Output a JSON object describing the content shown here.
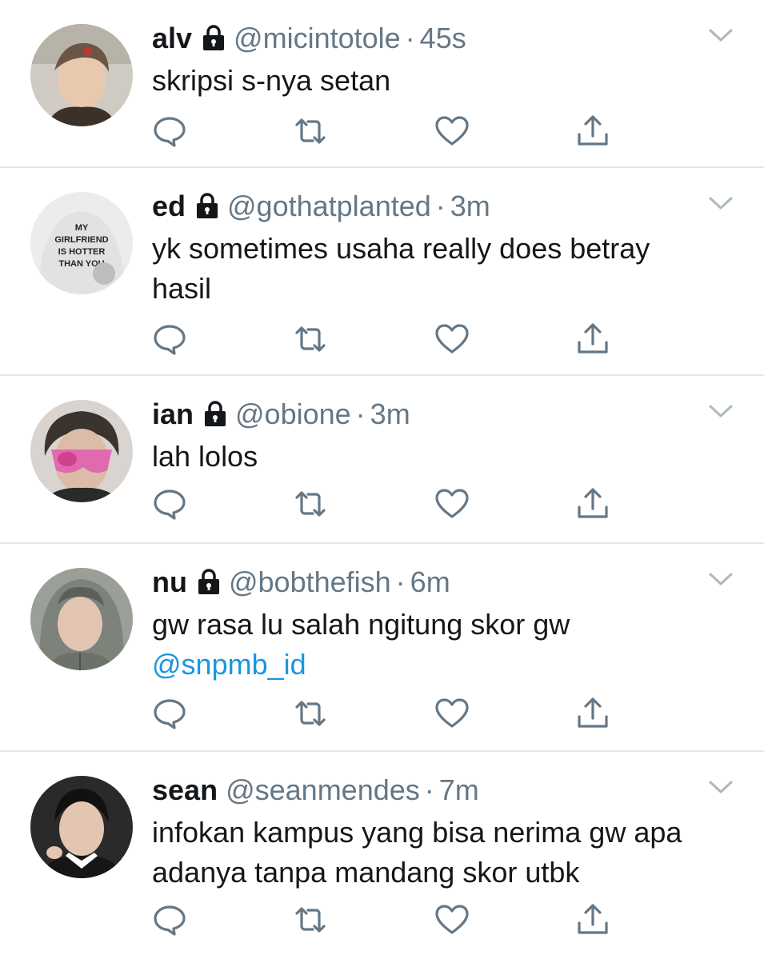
{
  "tweets": [
    {
      "name": "alv",
      "handle": "@micintotole",
      "time": "45s",
      "locked": true,
      "text": "skripsi s-nya setan",
      "mention": "",
      "avatar_icon": "avatar-photo",
      "avatar_colors": [
        "#c9c6bd",
        "#5a4a3c",
        "#e6c8ae"
      ]
    },
    {
      "name": "ed",
      "handle": "@gothatplanted",
      "time": "3m",
      "locked": true,
      "text": "yk sometimes usaha really does betray hasil",
      "mention": "",
      "avatar_icon": "avatar-photo",
      "avatar_colors": [
        "#e9e9e9",
        "#d8d8d8",
        "#222222"
      ],
      "avatar_shirt_text": [
        "MY",
        "GIRLFRIEND",
        "IS HOTTER",
        "THAN YOU"
      ]
    },
    {
      "name": "ian",
      "handle": "@obione",
      "time": "3m",
      "locked": true,
      "text": "lah lolos",
      "mention": "",
      "avatar_icon": "avatar-photo",
      "avatar_colors": [
        "#3a332e",
        "#e05fb0",
        "#d8b9a6"
      ]
    },
    {
      "name": "nu",
      "handle": "@bobthefish",
      "time": "6m",
      "locked": true,
      "text": "gw rasa lu salah ngitung skor gw",
      "mention": "@snpmb_id",
      "avatar_icon": "avatar-photo",
      "avatar_colors": [
        "#8a8f86",
        "#6c6f68",
        "#e2c4b2"
      ]
    },
    {
      "name": "sean",
      "handle": "@seanmendes",
      "time": "7m",
      "locked": false,
      "text": "infokan kampus yang bisa nerima gw apa adanya tanpa mandang skor utbk",
      "mention": "",
      "avatar_icon": "avatar-photo",
      "avatar_colors": [
        "#1a1a1a",
        "#ffffff",
        "#e4c5b1"
      ]
    }
  ],
  "icons": {
    "lock": "lock-icon",
    "chevron": "chevron-down-icon",
    "reply": "reply-icon",
    "retweet": "retweet-icon",
    "like": "heart-icon",
    "share": "share-icon"
  },
  "colors": {
    "text": "#14171a",
    "secondary": "#657786",
    "link": "#1b95e0",
    "divider": "#e1e8ed",
    "icon": "#657786"
  }
}
